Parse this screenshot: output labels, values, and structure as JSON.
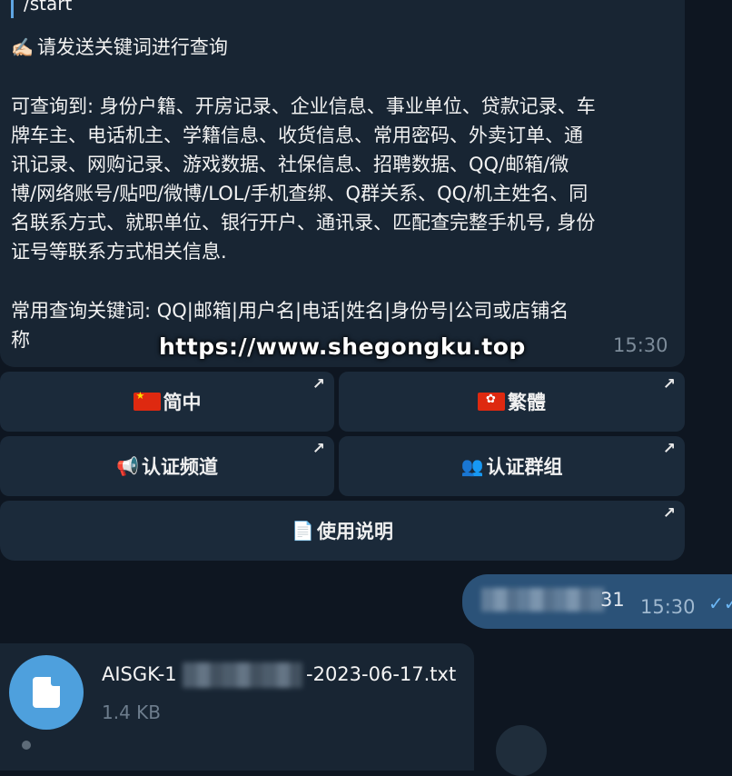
{
  "message_in": {
    "quoted_command": "/start",
    "emoji_hand": "✍🏻",
    "prompt_line": "请发送关键词进行查询",
    "lines": [
      "可查询到: 身份户籍、开房记录、企业信息、事业单位、贷款记录、车",
      "牌车主、电话机主、学籍信息、收货信息、常用密码、外卖订单、通",
      "讯记录、网购记录、游戏数据、社保信息、招聘数据、QQ/邮箱/微",
      "博/网络账号/贴吧/微博/LOL/手机查绑、Q群关系、QQ/机主姓名、同",
      "名联系方式、就职单位、银行开户、通讯录、匹配查完整手机号, 身份",
      "证号等联系方式相关信息."
    ],
    "keyword_lines": [
      "常用查询关键词: QQ|邮箱|用户名|电话|姓名|身份号|公司或店铺名",
      "称"
    ],
    "time": "15:30"
  },
  "watermark": "https://www.shegongku.top",
  "keyboard": {
    "buttons": [
      {
        "label": "简中",
        "icon": "china-flag-icon"
      },
      {
        "label": "繁體",
        "icon": "hong-kong-flag-icon"
      },
      {
        "label": "认证频道",
        "icon": "megaphone-icon",
        "glyph": "📢"
      },
      {
        "label": "认证群组",
        "icon": "people-icon",
        "glyph": "👥"
      },
      {
        "label": "使用说明",
        "icon": "document-icon",
        "glyph": "📄"
      }
    ],
    "arrow_glyph": "↗"
  },
  "message_out": {
    "visible_suffix": "31",
    "time": "15:30",
    "status_glyph": "✓✓"
  },
  "file_message": {
    "name_prefix": "AISGK-1",
    "name_suffix": "-2023-06-17.txt",
    "size": "1.4 KB"
  },
  "colors": {
    "background": "#0e1621",
    "bubble_in": "#182533",
    "bubble_out": "#2b5278",
    "accent": "#4ea0dd"
  }
}
